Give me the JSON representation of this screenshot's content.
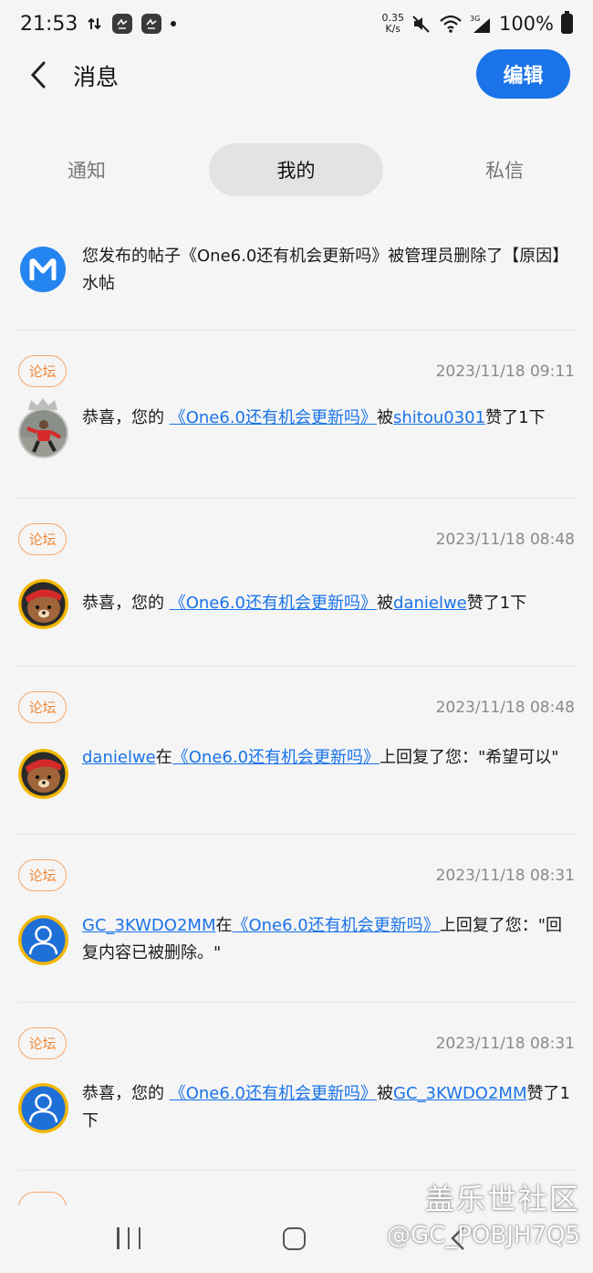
{
  "status_bar": {
    "time": "21:53",
    "speed_value": "0.35",
    "speed_unit": "K/s",
    "network": "3G",
    "battery": "100%"
  },
  "header": {
    "title": "消息",
    "edit_label": "编辑"
  },
  "tabs": [
    {
      "label": "通知",
      "active": false
    },
    {
      "label": "我的",
      "active": true
    },
    {
      "label": "私信",
      "active": false
    }
  ],
  "system_message": {
    "avatar_letter": "M",
    "text": "您发布的帖子《One6.0还有机会更新吗》被管理员删除了【原因】水帖"
  },
  "items": [
    {
      "tag": "论坛",
      "timestamp": "2023/11/18 09:11",
      "avatar": "user-red-shirt-avatar",
      "prefix": "恭喜，您的 ",
      "post_link": "《One6.0还有机会更新吗》",
      "middle": "被",
      "user_link": "shitou0301",
      "suffix": "赞了1下"
    },
    {
      "tag": "论坛",
      "timestamp": "2023/11/18 08:48",
      "avatar": "brown-bear-avatar",
      "prefix": "恭喜，您的 ",
      "post_link": "《One6.0还有机会更新吗》",
      "middle": "被",
      "user_link": "danielwe",
      "suffix": "赞了1下"
    },
    {
      "tag": "论坛",
      "timestamp": "2023/11/18 08:48",
      "avatar": "brown-bear-avatar",
      "user_link": "danielwe",
      "middle": "在",
      "post_link": "《One6.0还有机会更新吗》",
      "suffix": "上回复了您：\"希望可以\""
    },
    {
      "tag": "论坛",
      "timestamp": "2023/11/18 08:31",
      "avatar": "default-user-avatar",
      "user_link": "GC_3KWDO2MM",
      "middle": "在",
      "post_link": "《One6.0还有机会更新吗》",
      "suffix": "上回复了您：\"回复内容已被删除。\""
    },
    {
      "tag": "论坛",
      "timestamp": "2023/11/18 08:31",
      "avatar": "default-user-avatar",
      "prefix": "恭喜，您的 ",
      "post_link": "《One6.0还有机会更新吗》",
      "middle": "被",
      "user_link": "GC_3KWDO2MM",
      "suffix": "赞了1下"
    }
  ],
  "watermark": {
    "line1": "盖乐世社区",
    "line2": "@GC_POBJH7Q5"
  },
  "colors": {
    "accent": "#1a73e8",
    "tag_orange": "#f08a3c",
    "background": "#f5f5f5"
  }
}
